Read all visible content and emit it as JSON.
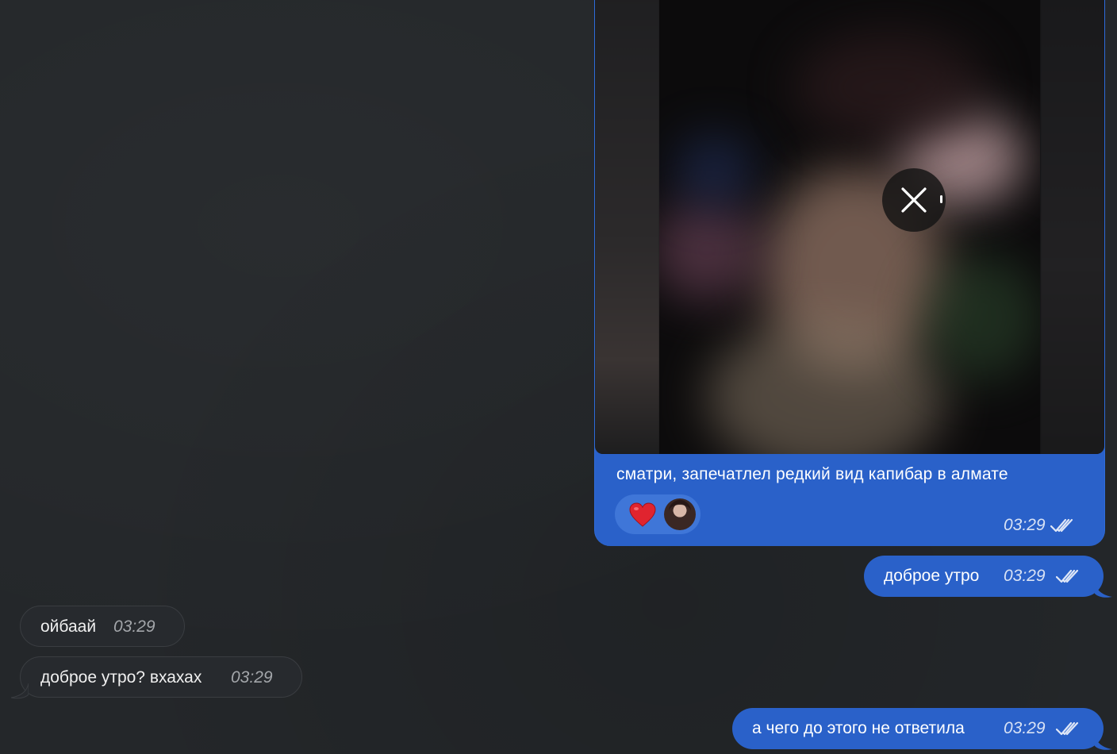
{
  "theme": {
    "background": "#24272a",
    "outgoing_bubble": "#2a61c9",
    "incoming_bubble": "#272a2e",
    "reaction_pill": "#3f76d8"
  },
  "media_message": {
    "caption": "сматри, запечатлел редкий вид капибар в алмате",
    "time": "03:29",
    "status_icon": "double-check-icon",
    "close_icon": "close-icon",
    "reactions": [
      {
        "emoji_icon": "heart-icon",
        "reactor": "reactor-avatar"
      }
    ]
  },
  "messages": [
    {
      "direction": "out",
      "text": "доброе утро",
      "time": "03:29",
      "status_icon": "double-check-icon"
    },
    {
      "direction": "in",
      "text": "ойбаай",
      "time": "03:29"
    },
    {
      "direction": "in",
      "text": "доброе утро? вхахах",
      "time": "03:29"
    },
    {
      "direction": "out",
      "text": "а чего до этого не ответила",
      "time": "03:29",
      "status_icon": "double-check-icon"
    }
  ]
}
